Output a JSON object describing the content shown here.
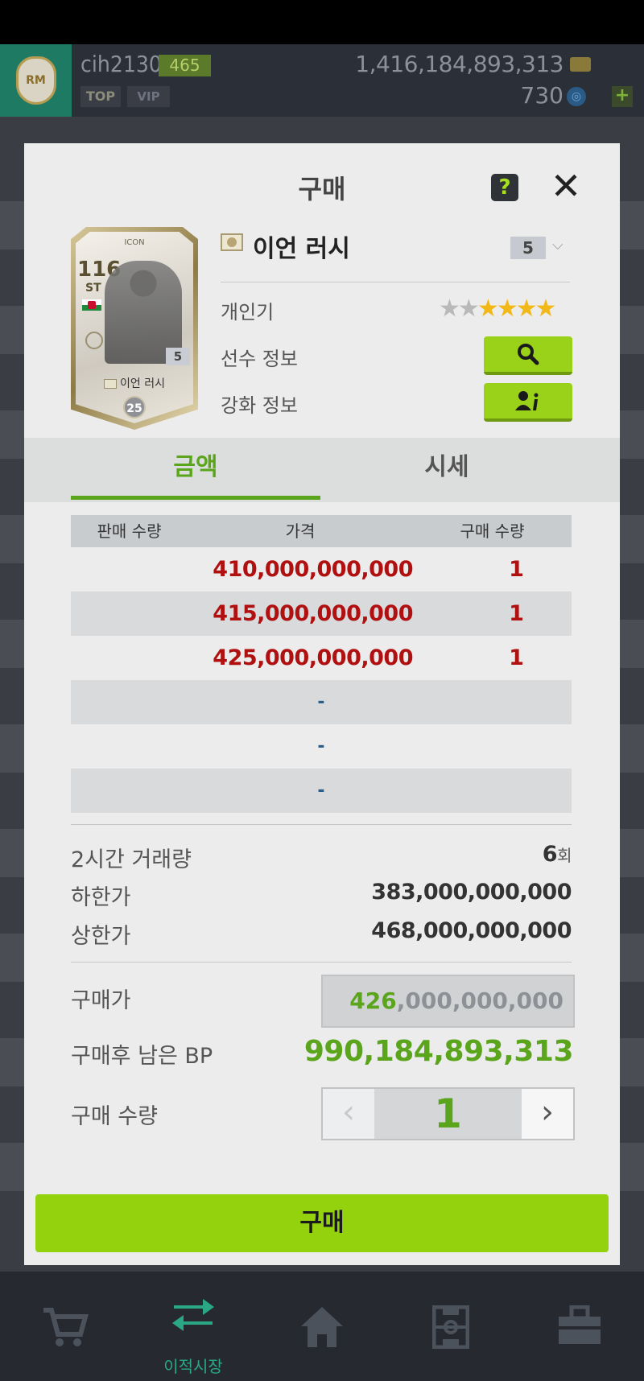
{
  "topbar": {
    "username": "cih2130",
    "level": "465",
    "tag_top": "TOP",
    "tag_vip": "VIP",
    "bp_value": "1,416,184,893,313",
    "fc_value": "730",
    "plus_label": "+"
  },
  "modal": {
    "title": "구매",
    "help_label": "?",
    "close_label": "✕",
    "card": {
      "icon_label": "ICON",
      "ovr": "116",
      "position": "ST",
      "grade": "5",
      "name": "이언 러시",
      "salary": "25"
    },
    "player_name": "이언 러시",
    "grade_selected": "5",
    "info": {
      "popularity_label": "개인기",
      "popularity_stars_total": 6,
      "popularity_stars_filled": 4,
      "player_info_label": "선수 정보",
      "upgrade_info_label": "강화 정보"
    },
    "tabs": {
      "amount": "금액",
      "market": "시세"
    },
    "table": {
      "headers": [
        "판매 수량",
        "가격",
        "구매 수량"
      ],
      "rows": [
        {
          "price": "410,000,000,000",
          "qty": "1"
        },
        {
          "price": "415,000,000,000",
          "qty": "1"
        },
        {
          "price": "425,000,000,000",
          "qty": "1"
        }
      ],
      "empty_rows": [
        "-",
        "-",
        "-"
      ]
    },
    "stats": {
      "volume_label": "2시간 거래량",
      "volume_value": "6",
      "volume_unit": "회",
      "min_label": "하한가",
      "min_value": "383,000,000,000",
      "max_label": "상한가",
      "max_value": "468,000,000,000"
    },
    "purchase": {
      "price_label": "구매가",
      "price_highlight": "426",
      "price_rest": ",000,000,000",
      "remaining_label": "구매후 남은 BP",
      "remaining_value": "990,184,893,313",
      "qty_label": "구매 수량",
      "qty_value": "1",
      "qty_dec": "‹",
      "qty_inc": "›"
    },
    "buy_button": "구매"
  },
  "bottom_nav": {
    "transfer_label": "이적시장"
  },
  "colors": {
    "accent_green": "#94d20e",
    "price_red": "#b01010",
    "tab_green": "#5aa51c",
    "nav_active": "#2aa886"
  }
}
